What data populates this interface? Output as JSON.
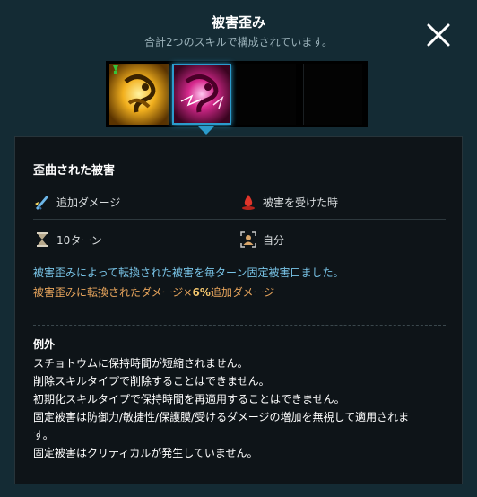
{
  "header": {
    "title": "被害歪み",
    "subtitle": "合計2つのスキルで構成されています。"
  },
  "skills": [
    {
      "name": "skill-1",
      "color": "#e0a21a"
    },
    {
      "name": "skill-2",
      "color": "#d5288c"
    }
  ],
  "detail": {
    "title": "歪曲された被害",
    "attributes": {
      "type": {
        "label": "追加ダメージ",
        "icon": "sword-spark-icon"
      },
      "trigger": {
        "label": "被害を受けた時",
        "icon": "blood-drop-icon"
      },
      "duration": {
        "label": "10ターン",
        "icon": "hourglass-icon"
      },
      "target": {
        "label": "自分",
        "icon": "self-target-icon"
      }
    },
    "description_1": "被害歪みによって転換された被害を毎ターン固定被害口ました。",
    "description_2_prefix": "被害歪みに転換されたダメージ×",
    "description_2_value": "6%",
    "description_2_suffix": "追加ダメージ",
    "exceptions_title": "例外",
    "exceptions": [
      "スチョトウムに保持時間が短縮されません。",
      "削除スキルタイプで削除することはできません。",
      "初期化スキルタイプで保持時間を再適用することはできません。",
      "固定被害は防御力/敏捷性/保護膜/受けるダメージの増加を無視して適用されま",
      "す。",
      "固定被害はクリティカルが発生していません。"
    ]
  },
  "colors": {
    "background": "#142b34",
    "panel": "#0e1418",
    "accent_blue": "#78c3e6",
    "accent_orange": "#e8a55c",
    "selected_border": "#2b9bcc"
  }
}
